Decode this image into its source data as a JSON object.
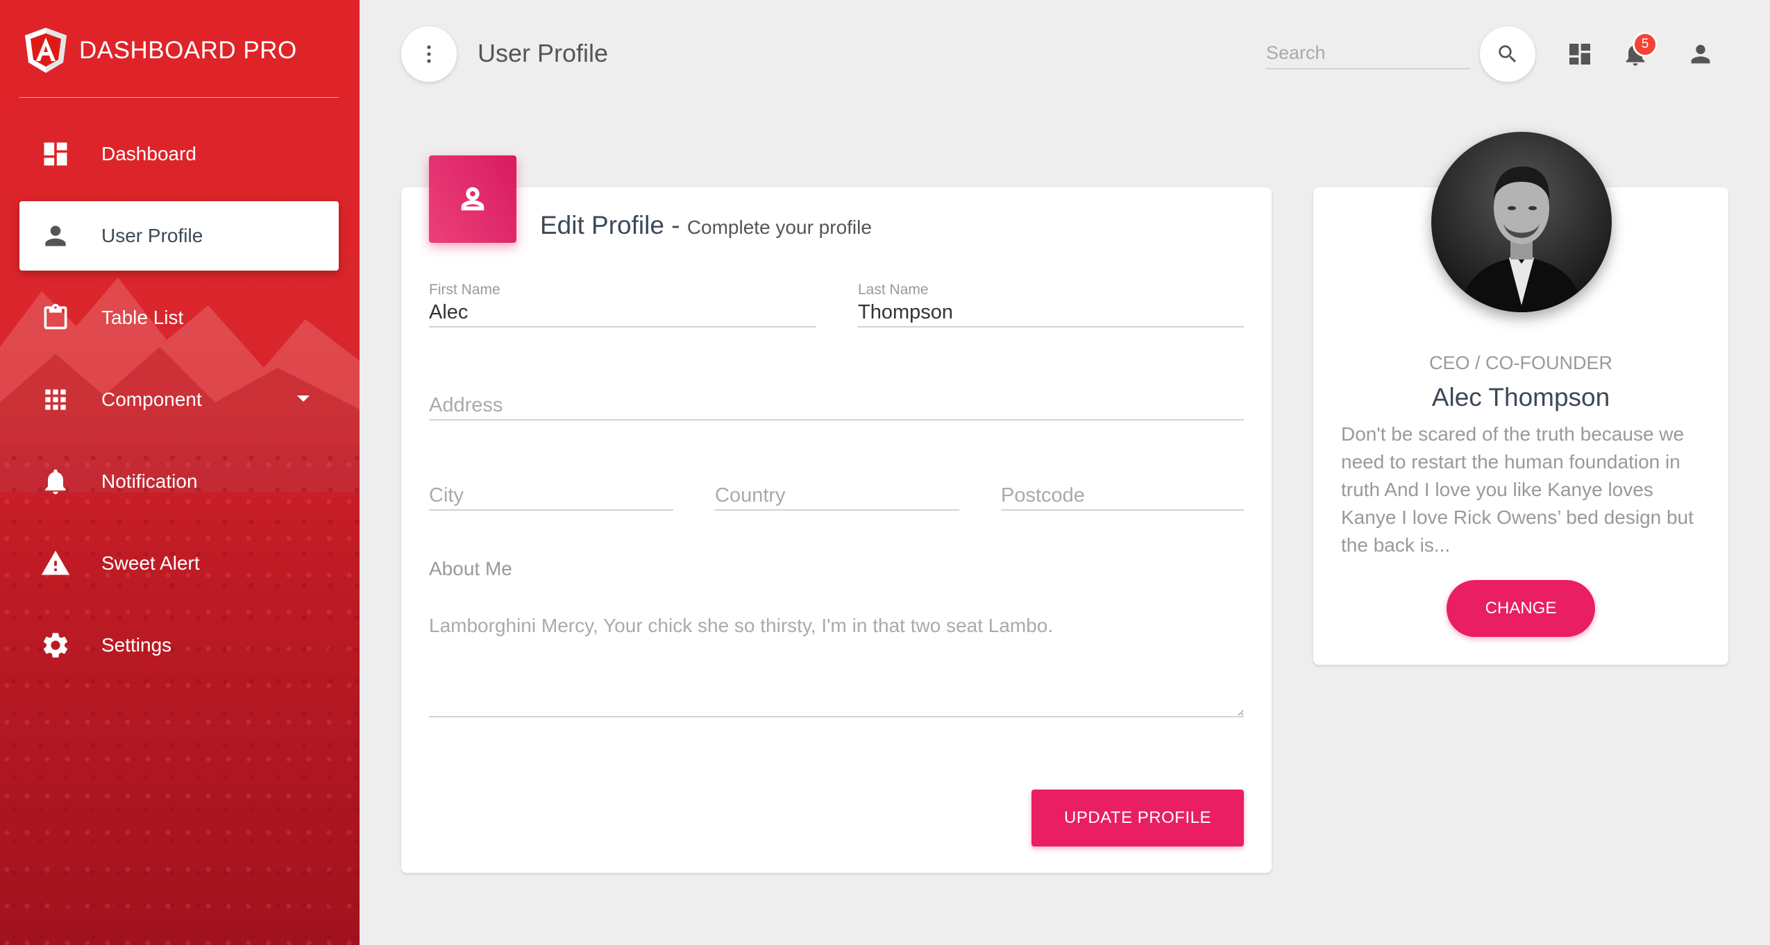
{
  "brand": {
    "name": "DASHBOARD PRO",
    "logo_icon": "angular-logo"
  },
  "sidebar": {
    "items": [
      {
        "label": "Dashboard",
        "icon": "dashboard-icon",
        "active": false
      },
      {
        "label": "User Profile",
        "icon": "person-icon",
        "active": true
      },
      {
        "label": "Table List",
        "icon": "clipboard-icon",
        "active": false
      },
      {
        "label": "Component",
        "icon": "apps-grid-icon",
        "active": false,
        "has_submenu": true
      },
      {
        "label": "Notification",
        "icon": "bell-icon",
        "active": false
      },
      {
        "label": "Sweet Alert",
        "icon": "warning-icon",
        "active": false
      },
      {
        "label": "Settings",
        "icon": "gear-icon",
        "active": false
      }
    ]
  },
  "topbar": {
    "title": "User Profile",
    "search_placeholder": "Search",
    "notification_count": "5"
  },
  "edit_profile": {
    "title": "Edit Profile",
    "separator": " - ",
    "subtitle": "Complete your profile",
    "fields": {
      "first_name": {
        "label": "First Name",
        "value": "Alec"
      },
      "last_name": {
        "label": "Last Name",
        "value": "Thompson"
      },
      "address": {
        "placeholder": "Address"
      },
      "city": {
        "placeholder": "City"
      },
      "country": {
        "placeholder": "Country"
      },
      "postcode": {
        "placeholder": "Postcode"
      }
    },
    "about_label": "About Me",
    "about_placeholder": "Lamborghini Mercy, Your chick she so thirsty, I'm in that two seat Lambo.",
    "update_button": "UPDATE PROFILE"
  },
  "profile": {
    "role": "CEO / CO-FOUNDER",
    "name": "Alec Thompson",
    "description": "Don't be scared of the truth because we need to restart the human foundation in truth And I love you like Kanye loves Kanye I love Rick Owens’ bed design but the back is...",
    "change_button": "CHANGE"
  },
  "colors": {
    "accent": "#e91e63",
    "sidebar_red": "#d9262c",
    "badge": "#f44336",
    "background": "#eeeeee"
  }
}
